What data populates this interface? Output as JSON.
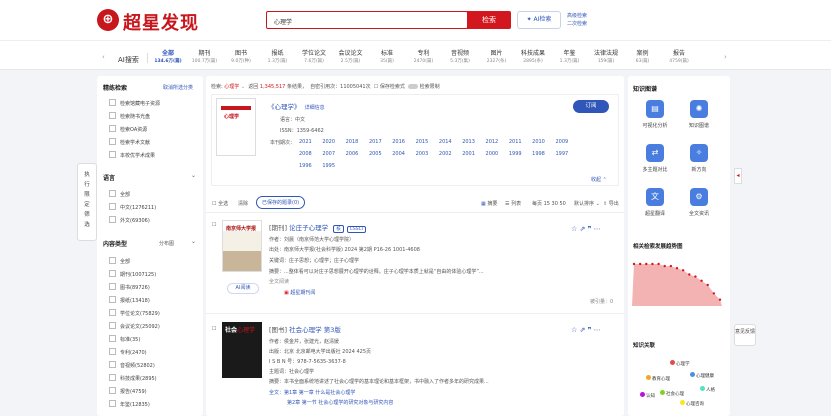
{
  "header": {
    "logo_mark": "SS",
    "logo_text": "超星发现",
    "search_value": "心理学",
    "search_button": "检索",
    "ai_button": "AI检索",
    "advanced": "高级检索",
    "secondary": "二次检索"
  },
  "categories": {
    "ai_label": "AI搜索",
    "items": [
      {
        "name": "全部",
        "count": "134.6万(篇)",
        "active": true
      },
      {
        "name": "期刊",
        "count": "100.7万(篇)"
      },
      {
        "name": "图书",
        "count": "9.0万(种)"
      },
      {
        "name": "报纸",
        "count": "1.3万(篇)"
      },
      {
        "name": "学位论文",
        "count": "7.6万(篇)"
      },
      {
        "name": "会议论文",
        "count": "2.5万(篇)"
      },
      {
        "name": "标准",
        "count": "35(篇)"
      },
      {
        "name": "专利",
        "count": "2470(篇)"
      },
      {
        "name": "音视频",
        "count": "5.3万(集)"
      },
      {
        "name": "图片",
        "count": "2327(条)"
      },
      {
        "name": "科技成果",
        "count": "2895(条)"
      },
      {
        "name": "年鉴",
        "count": "1.3万(篇)"
      },
      {
        "name": "法律法规",
        "count": "159(篇)"
      },
      {
        "name": "案例",
        "count": "63(篇)"
      },
      {
        "name": "报告",
        "count": "4759(篇)"
      }
    ]
  },
  "left": {
    "precise_title": "精练检索",
    "cancel_all": "取消所选分类",
    "precise_items": [
      "检索馆藏电子资源",
      "检索随书光盘",
      "检索OA资源",
      "检索学术文献",
      "本校优学术成果"
    ],
    "lang_title": "语言",
    "lang_items": [
      "全部",
      "中文(1276211)",
      "外文(69306)"
    ],
    "type_title": "内容类型",
    "type_link": "分布图",
    "type_items": [
      "全部",
      "期刊(1007125)",
      "图书(89726)",
      "报纸(13418)",
      "学位论文(75829)",
      "会议论文(25092)",
      "标准(35)",
      "专利(2470)",
      "音视频(52802)",
      "科技成果(2895)",
      "报告(4759)",
      "年鉴(12835)"
    ],
    "vtab": [
      "执",
      "行",
      "限",
      "定",
      "筛",
      "选"
    ]
  },
  "main": {
    "search_prefix": "检索:",
    "search_term": "心理学",
    "result_prefix": "返回",
    "result_count": "1,345,517",
    "result_suffix": "条结果，",
    "citation": "自密引用次：11005041次",
    "save_exp": "保存检索式",
    "exact": "检索限制",
    "journal_title": "《心理学》",
    "journal_detail": "详细信息",
    "journal_lang": "语言：中文",
    "journal_issn": "ISSN：1359-6462",
    "journal_year_label": "本刊期次：",
    "years_row1": "2021 2020 2018 2017 2016 2015 2014 2013 2012 2011 2010 2009",
    "years_row2": "2008 2007 2006 2005 2004 2003 2002 2001 2000 1999 1998 1997",
    "years_row3": "1996 1995",
    "subscribe": "订阅",
    "collapse": "收起",
    "cover_text": "心理学",
    "toolbar": {
      "select_all": "全选",
      "clear": "清除",
      "save_all": "已保存的题录(0)",
      "summary": "摘要",
      "list": "列表",
      "page": "每页 15 30 50",
      "sort": "默认排序",
      "export": "导出"
    },
    "items": [
      {
        "type": "[期刊]",
        "title": "论庄子心理学",
        "tags": [
          "核",
          "CSSCI"
        ],
        "author": "作者：刘晨（南京师范大学心理学院）",
        "source": "出处：南京师大学报(社会科学版) 2024 第2期 P16-26  1001-4608",
        "keywords": "关键词：庄子思想；心理学；庄子心理学",
        "abstract": "摘要：...整体看可以对庄子思想展开心理学的诠释。庄子心理学本质上就是“自由的体验心理学”...",
        "ai": "AI阅读",
        "read": "全文阅读",
        "link": "超星期刊阅",
        "stats": "被引量：0"
      },
      {
        "type": "[图书]",
        "title": "社会心理学 第3版",
        "tags": [],
        "author": "作者：侯金芹，张建光，赵清媛",
        "source": "出版：北京 北京邮电大学出版社 2024 425页",
        "isbn": "I S B N 号：978-7-5635-3637-8",
        "keywords": "主题词：社会心理学",
        "abstract": "摘要：本书全面系统地讲述了社会心理学的基本理论和基本框架，书中融入了作者多年的研究成果...",
        "ch1": "全文：第1章 第一章 什么是社会心理学",
        "ch2": "第2章 第一节 社会心理学的研究对象与研究内容"
      }
    ]
  },
  "right": {
    "title": "知识图谱",
    "icons": [
      {
        "label": "可视化分析",
        "icon": "chart-icon"
      },
      {
        "label": "知识图谱",
        "icon": "graph-icon"
      },
      {
        "label": "多主题对比",
        "icon": "compare-icon"
      },
      {
        "label": "新方向",
        "icon": "compass-icon"
      },
      {
        "label": "超星翻译",
        "icon": "translate-icon"
      },
      {
        "label": "全文资讯",
        "icon": "news-icon"
      }
    ],
    "trend_title": "相关检索发展趋势图",
    "trend_values": [
      20,
      20,
      20,
      20,
      20,
      19,
      19,
      18,
      17,
      15,
      14,
      12,
      10,
      6,
      3
    ],
    "rel_title": "知识关联",
    "rel_words": [
      "心理学",
      "教育心理",
      "心理健康",
      "社会心理",
      "认知",
      "人格",
      "心理咨询"
    ]
  },
  "float": {
    "feedback": "意见反馈"
  }
}
